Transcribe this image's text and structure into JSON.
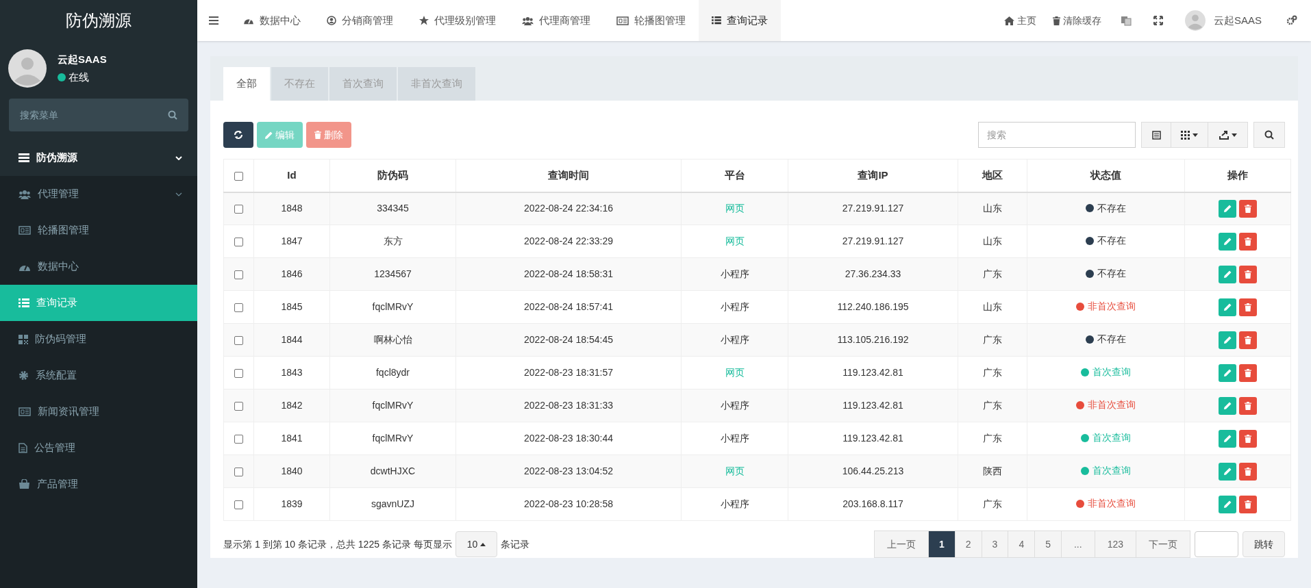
{
  "logo": "防伪溯源",
  "user": {
    "name": "云起SAAS",
    "status": "在线"
  },
  "sidebar": {
    "search": {
      "placeholder": "搜索菜单"
    },
    "items": [
      {
        "label": "防伪溯源",
        "kind": "group",
        "expandable": true,
        "selected": false
      },
      {
        "label": "代理管理",
        "kind": "item",
        "expandable": true,
        "selected": false
      },
      {
        "label": "轮播图管理",
        "kind": "item",
        "expandable": false,
        "selected": false
      },
      {
        "label": "数据中心",
        "kind": "item",
        "expandable": false,
        "selected": false
      },
      {
        "label": "查询记录",
        "kind": "item",
        "expandable": false,
        "selected": true
      },
      {
        "label": "防伪码管理",
        "kind": "item",
        "expandable": false,
        "selected": false
      },
      {
        "label": "系统配置",
        "kind": "item",
        "expandable": false,
        "selected": false
      },
      {
        "label": "新闻资讯管理",
        "kind": "item",
        "expandable": false,
        "selected": false
      },
      {
        "label": "公告管理",
        "kind": "item",
        "expandable": false,
        "selected": false
      },
      {
        "label": "产品管理",
        "kind": "item",
        "expandable": false,
        "selected": false
      }
    ]
  },
  "top_tabs": [
    {
      "label": "数据中心",
      "selected": false
    },
    {
      "label": "分销商管理",
      "selected": false
    },
    {
      "label": "代理级别管理",
      "selected": false
    },
    {
      "label": "代理商管理",
      "selected": false
    },
    {
      "label": "轮播图管理",
      "selected": false
    },
    {
      "label": "查询记录",
      "selected": true
    }
  ],
  "top_right": {
    "home": "主页",
    "clear_cache": "清除缓存",
    "user": "云起SAAS"
  },
  "filter_tabs": [
    {
      "label": "全部",
      "selected": true
    },
    {
      "label": "不存在",
      "selected": false
    },
    {
      "label": "首次查询",
      "selected": false
    },
    {
      "label": "非首次查询",
      "selected": false
    }
  ],
  "toolbar": {
    "edit": "编辑",
    "delete": "删除",
    "search_placeholder": "搜索"
  },
  "table": {
    "header_checked": false,
    "columns": [
      "Id",
      "防伪码",
      "查询时间",
      "平台",
      "查询IP",
      "地区",
      "状态值",
      "操作"
    ],
    "rows": [
      {
        "checked": false,
        "id": "1848",
        "code": "334345",
        "time": "2022-08-24 22:34:16",
        "platform": "网页",
        "platform_link": true,
        "ip": "27.219.91.127",
        "region": "山东",
        "status": "不存在",
        "color": "#2c3e50"
      },
      {
        "checked": false,
        "id": "1847",
        "code": "东方",
        "time": "2022-08-24 22:33:29",
        "platform": "网页",
        "platform_link": true,
        "ip": "27.219.91.127",
        "region": "山东",
        "status": "不存在",
        "color": "#2c3e50"
      },
      {
        "checked": false,
        "id": "1846",
        "code": "1234567",
        "time": "2022-08-24 18:58:31",
        "platform": "小程序",
        "platform_link": false,
        "ip": "27.36.234.33",
        "region": "广东",
        "status": "不存在",
        "color": "#2c3e50"
      },
      {
        "checked": false,
        "id": "1845",
        "code": "fqclMRvY",
        "time": "2022-08-24 18:57:41",
        "platform": "小程序",
        "platform_link": false,
        "ip": "112.240.186.195",
        "region": "山东",
        "status": "非首次查询",
        "color": "#e74c3c"
      },
      {
        "checked": false,
        "id": "1844",
        "code": "啊林心怡",
        "time": "2022-08-24 18:54:45",
        "platform": "小程序",
        "platform_link": false,
        "ip": "113.105.216.192",
        "region": "广东",
        "status": "不存在",
        "color": "#2c3e50"
      },
      {
        "checked": false,
        "id": "1843",
        "code": "fqcl8ydr",
        "time": "2022-08-23 18:31:57",
        "platform": "网页",
        "platform_link": true,
        "ip": "119.123.42.81",
        "region": "广东",
        "status": "首次查询",
        "color": "#18bc9c"
      },
      {
        "checked": false,
        "id": "1842",
        "code": "fqclMRvY",
        "time": "2022-08-23 18:31:33",
        "platform": "小程序",
        "platform_link": false,
        "ip": "119.123.42.81",
        "region": "广东",
        "status": "非首次查询",
        "color": "#e74c3c"
      },
      {
        "checked": false,
        "id": "1841",
        "code": "fqclMRvY",
        "time": "2022-08-23 18:30:44",
        "platform": "小程序",
        "platform_link": false,
        "ip": "119.123.42.81",
        "region": "广东",
        "status": "首次查询",
        "color": "#18bc9c"
      },
      {
        "checked": false,
        "id": "1840",
        "code": "dcwtHJXC",
        "time": "2022-08-23 13:04:52",
        "platform": "网页",
        "platform_link": true,
        "ip": "106.44.25.213",
        "region": "陕西",
        "status": "首次查询",
        "color": "#18bc9c"
      },
      {
        "checked": false,
        "id": "1839",
        "code": "sgavnUZJ",
        "time": "2022-08-23 10:28:58",
        "platform": "小程序",
        "platform_link": false,
        "ip": "203.168.8.117",
        "region": "广东",
        "status": "非首次查询",
        "color": "#e74c3c"
      }
    ]
  },
  "pagination": {
    "summary": "显示第 1 到第 10 条记录，总共 1225 条记录 每页显示",
    "page_size": "10",
    "suffix": "条记录",
    "pages": [
      {
        "label": "上一页",
        "selected": false
      },
      {
        "label": "1",
        "selected": true
      },
      {
        "label": "2",
        "selected": false
      },
      {
        "label": "3",
        "selected": false
      },
      {
        "label": "4",
        "selected": false
      },
      {
        "label": "5",
        "selected": false
      },
      {
        "label": "...",
        "selected": false
      },
      {
        "label": "123",
        "selected": false
      },
      {
        "label": "下一页",
        "selected": false
      }
    ],
    "jump": "跳转"
  }
}
